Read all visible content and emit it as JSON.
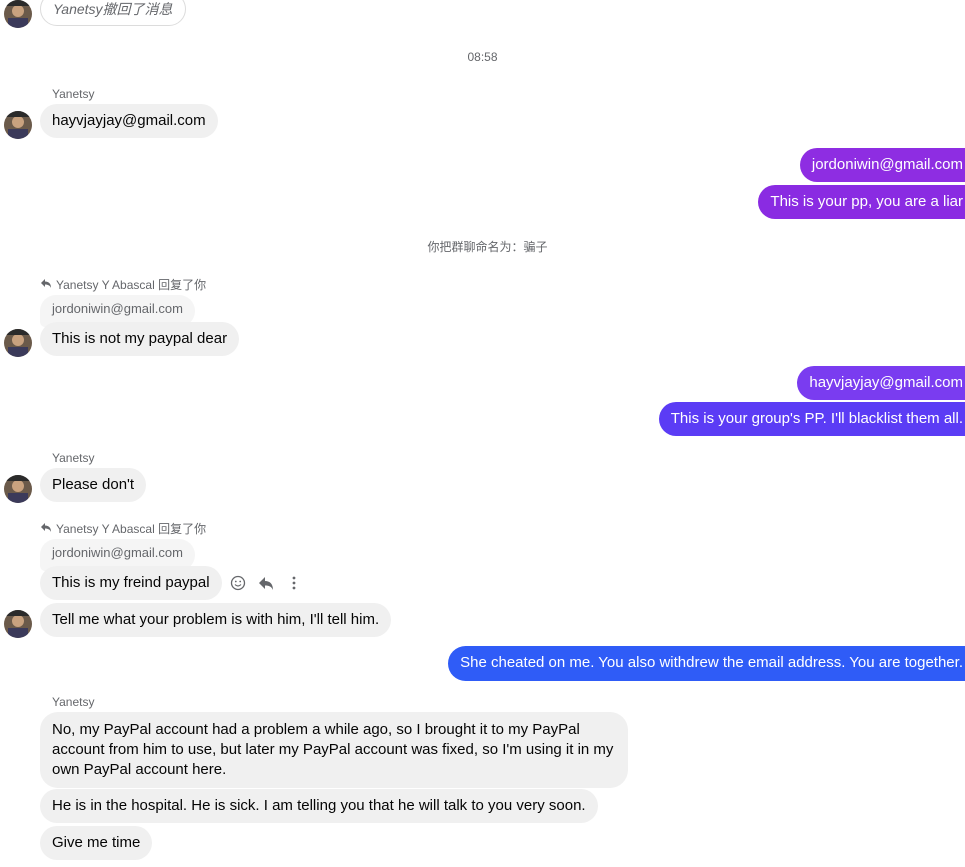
{
  "top_recall": {
    "text": "Yanetsy撤回了消息"
  },
  "timestamp": "08:58",
  "group_rename_notice": "你把群聊命名为：骗子",
  "messages": {
    "m1_sender": "Yanetsy",
    "m1_text": "hayvjayjay@gmail.com",
    "m2_text": "jordoniwin@gmail.com",
    "m3_text": "This is your pp, you are a liar",
    "m4_reply_label": "Yanetsy Y Abascal 回复了你",
    "m4_quote": "jordoniwin@gmail.com",
    "m4_text": "This is not my paypal dear",
    "m5_text": "hayvjayjay@gmail.com",
    "m6_text": "This is your group's PP. I'll blacklist them all.",
    "m7_sender": "Yanetsy",
    "m7_text": "Please don't",
    "m8_reply_label": "Yanetsy Y Abascal 回复了你",
    "m8_quote": "jordoniwin@gmail.com",
    "m8_text": "This is my freind paypal",
    "m9_text": "Tell me what your problem is with him, I'll tell him.",
    "m10_text": "She cheated on me. You also withdrew the email address. You are together.",
    "m11_sender": "Yanetsy",
    "m11_text": "No, my PayPal account had a problem a while ago, so I brought it to my PayPal account from him to use, but later my PayPal account was fixed, so I'm using it in my own PayPal account here.",
    "m12_text": "He is in the hospital. He is sick. I am telling you that he will talk to you very soon.",
    "m13_text": "Give me time"
  },
  "icons": {
    "avatar": "avatar",
    "reply": "reply-arrow-icon",
    "emoji": "emoji-icon",
    "more": "more-vertical-icon"
  },
  "colors": {
    "out_purple": "#8a2be2",
    "out_gradient_end": "#2f5cf7",
    "incoming_bg": "#f0f0f0",
    "meta_text": "#65676b"
  }
}
